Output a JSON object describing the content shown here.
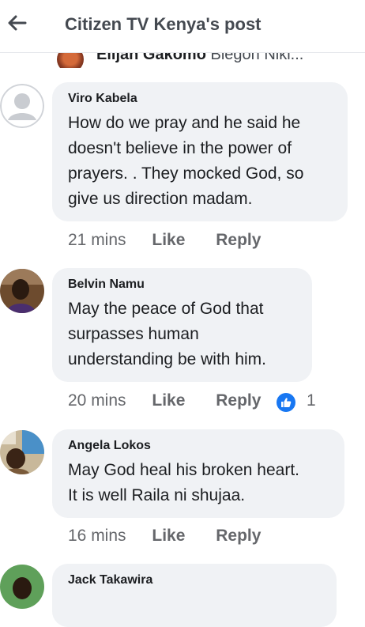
{
  "header": {
    "title": "Citizen TV Kenya's post"
  },
  "previous": {
    "name": "Elijah Gakomo",
    "text": "Blegon Niki..."
  },
  "comments": [
    {
      "author": "Viro Kabela",
      "text": "How do we pray and he said he\ndoesn't believe in the power of\nprayers. . They mocked God, so\ngive us direction madam.",
      "time": "21 mins",
      "like": "Like",
      "reply": "Reply"
    },
    {
      "author": "Belvin Namu",
      "text": "May the peace of God that\nsurpasses human\nunderstanding be with him.",
      "time": "20 mins",
      "like": "Like",
      "reply": "Reply",
      "reaction_count": "1"
    },
    {
      "author": "Angela Lokos",
      "text": "May God heal his broken heart.\nIt is well Raila ni shujaa.",
      "time": "16 mins",
      "like": "Like",
      "reply": "Reply"
    },
    {
      "author": "Jack Takawira",
      "text": ""
    }
  ],
  "colors": {
    "accent": "#1877f2",
    "bubble": "#f0f2f5",
    "meta": "#65676b"
  }
}
